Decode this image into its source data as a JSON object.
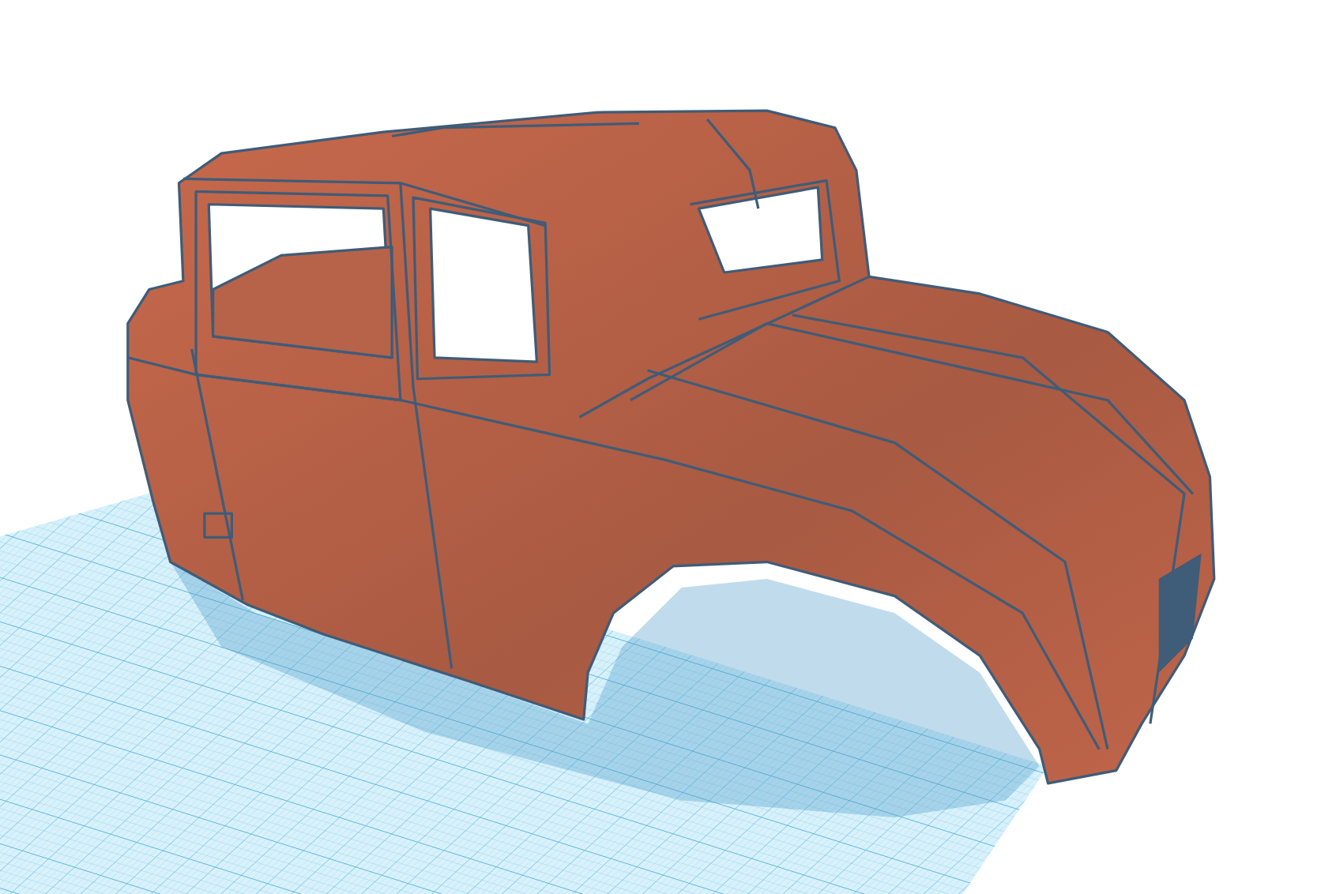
{
  "workplane": {
    "visible": true
  },
  "model": {
    "selected": true
  }
}
